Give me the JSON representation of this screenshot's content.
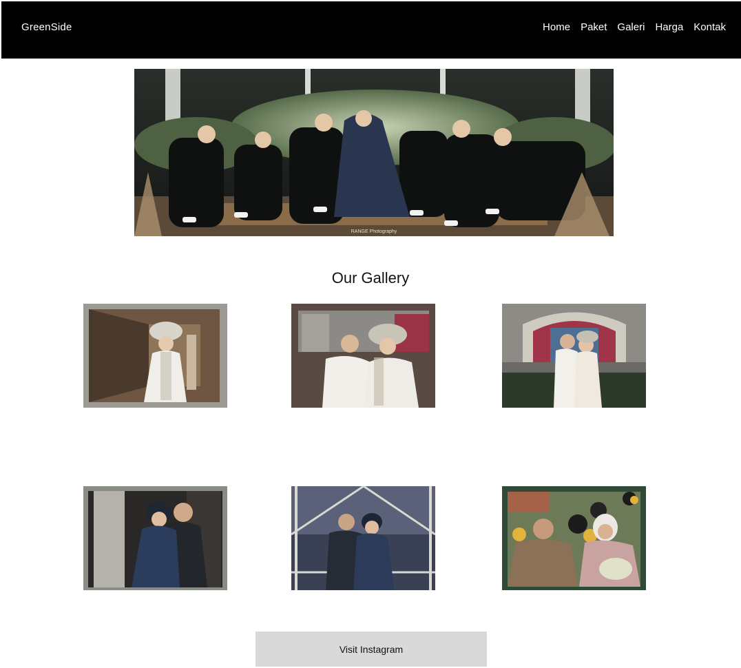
{
  "nav": {
    "brand": "GreenSide",
    "links": [
      "Home",
      "Paket",
      "Galeri",
      "Harga",
      "Kontak"
    ]
  },
  "hero": {
    "watermark": "RANGE Photography"
  },
  "gallery": {
    "title": "Our Gallery"
  },
  "cta": {
    "label": "Visit Instagram"
  },
  "colors": {
    "navbar_bg": "#000000",
    "button_bg": "#d9d9d9",
    "page_bg": "#ffffff"
  }
}
